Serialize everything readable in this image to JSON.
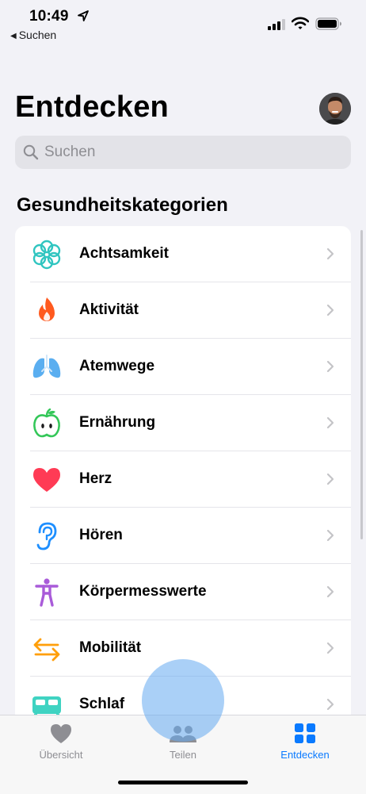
{
  "status_bar": {
    "time": "10:49",
    "back_label": "Suchen"
  },
  "header": {
    "title": "Entdecken",
    "search_placeholder": "Suchen"
  },
  "section": {
    "title": "Gesundheitskategorien"
  },
  "categories": [
    {
      "label": "Achtsamkeit",
      "icon": "mindfulness-icon",
      "color": "#2fc5c0"
    },
    {
      "label": "Aktivität",
      "icon": "flame-icon",
      "color": "#ff5a1f"
    },
    {
      "label": "Atemwege",
      "icon": "lungs-icon",
      "color": "#5aaef0"
    },
    {
      "label": "Ernährung",
      "icon": "apple-icon",
      "color": "#34c759"
    },
    {
      "label": "Herz",
      "icon": "heart-icon",
      "color": "#ff3b55"
    },
    {
      "label": "Hören",
      "icon": "ear-icon",
      "color": "#1e8fff"
    },
    {
      "label": "Körpermesswerte",
      "icon": "figure-icon",
      "color": "#a95bd9"
    },
    {
      "label": "Mobilität",
      "icon": "arrows-icon",
      "color": "#ff9f0a"
    },
    {
      "label": "Schlaf",
      "icon": "bed-icon",
      "color": "#3fd3c2"
    }
  ],
  "tabbar": {
    "tabs": [
      {
        "label": "Übersicht",
        "icon": "heart-icon",
        "active": false
      },
      {
        "label": "Teilen",
        "icon": "people-icon",
        "active": false
      },
      {
        "label": "Entdecken",
        "icon": "grid-icon",
        "active": true
      }
    ]
  },
  "colors": {
    "accent": "#0a7aff",
    "background": "#f2f2f7"
  }
}
